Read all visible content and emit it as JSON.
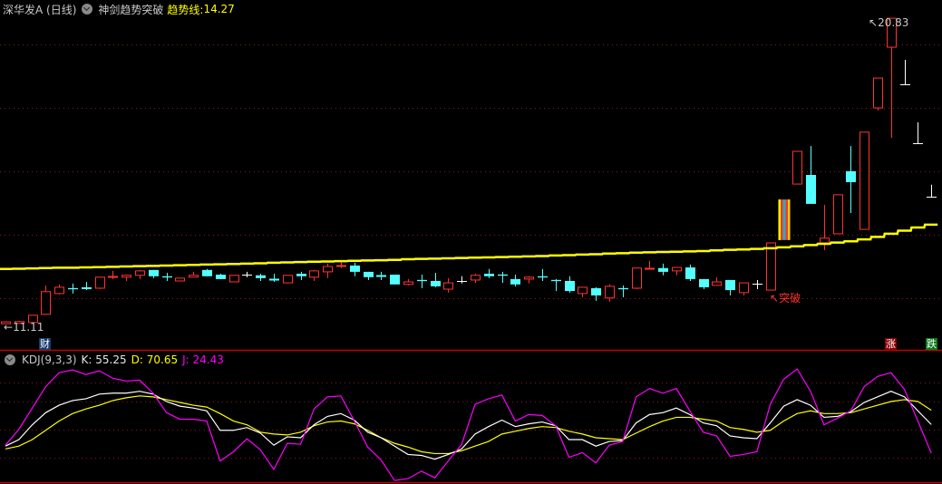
{
  "header": {
    "stock": "深华发A (日线)",
    "indicator_name": "神剑趋势突破",
    "trend_label": "趋势线:",
    "trend_value": "14.27"
  },
  "kdj_header": {
    "label": "KDJ(9,3,3)",
    "k": "K: 55.25",
    "d": "D: 70.65",
    "j": "J: 24.43"
  },
  "labels": {
    "max_price": "20.83",
    "min_price": "11.11",
    "breakout": "突破",
    "badge_finance": "财",
    "badge_up": "涨",
    "badge_down": "跌"
  },
  "colors": {
    "up": "#ff3232",
    "down": "#54ffff",
    "doji": "#ffffff",
    "trend": "#ffff00",
    "k": "#ffffff",
    "d": "#ffff00",
    "j": "#ff00ff",
    "grid": "#8b1a1a",
    "divider": "#c00000"
  },
  "chart_data": [
    {
      "type": "candlestick",
      "title": "深华发A (日线)",
      "ylim": [
        10.29,
        21.41
      ],
      "max_label": 20.83,
      "min_label": 11.11,
      "breakout_index": 58,
      "ohlc": [
        [
          11.12,
          11.2,
          11.11,
          11.18
        ],
        [
          11.13,
          11.21,
          11.12,
          11.19
        ],
        [
          11.16,
          11.39,
          11.15,
          11.39
        ],
        [
          11.42,
          12.34,
          11.4,
          12.14
        ],
        [
          12.08,
          12.37,
          12.05,
          12.28
        ],
        [
          12.26,
          12.4,
          12.08,
          12.25
        ],
        [
          12.28,
          12.45,
          12.19,
          12.22
        ],
        [
          12.25,
          12.6,
          12.22,
          12.6
        ],
        [
          12.6,
          12.8,
          12.54,
          12.63
        ],
        [
          12.6,
          12.68,
          12.48,
          12.66
        ],
        [
          12.66,
          12.83,
          12.54,
          12.8
        ],
        [
          12.83,
          12.83,
          12.57,
          12.63
        ],
        [
          12.61,
          12.74,
          12.48,
          12.6
        ],
        [
          12.48,
          12.57,
          12.48,
          12.57
        ],
        [
          12.6,
          12.77,
          12.6,
          12.66
        ],
        [
          12.83,
          12.86,
          12.63,
          12.63
        ],
        [
          12.68,
          12.71,
          12.54,
          12.54
        ],
        [
          12.45,
          12.66,
          12.45,
          12.66
        ],
        [
          12.68,
          12.77,
          12.6,
          12.68
        ],
        [
          12.66,
          12.71,
          12.48,
          12.57
        ],
        [
          12.54,
          12.71,
          12.45,
          12.51
        ],
        [
          12.42,
          12.66,
          12.42,
          12.66
        ],
        [
          12.71,
          12.77,
          12.51,
          12.63
        ],
        [
          12.6,
          12.83,
          12.48,
          12.8
        ],
        [
          12.77,
          13.03,
          12.57,
          12.94
        ],
        [
          12.94,
          13.14,
          12.89,
          12.97
        ],
        [
          12.97,
          13.06,
          12.63,
          12.77
        ],
        [
          12.77,
          12.77,
          12.51,
          12.6
        ],
        [
          12.66,
          12.77,
          12.51,
          12.63
        ],
        [
          12.68,
          12.68,
          12.37,
          12.37
        ],
        [
          12.37,
          12.54,
          12.34,
          12.45
        ],
        [
          12.52,
          12.68,
          12.25,
          12.51
        ],
        [
          12.48,
          12.74,
          12.28,
          12.31
        ],
        [
          12.22,
          12.57,
          12.11,
          12.42
        ],
        [
          12.48,
          12.63,
          12.4,
          12.48
        ],
        [
          12.51,
          12.71,
          12.42,
          12.66
        ],
        [
          12.71,
          12.86,
          12.57,
          12.63
        ],
        [
          12.69,
          12.77,
          12.42,
          12.68
        ],
        [
          12.54,
          12.68,
          12.31,
          12.37
        ],
        [
          12.54,
          12.63,
          12.4,
          12.6
        ],
        [
          12.61,
          12.86,
          12.48,
          12.6
        ],
        [
          12.52,
          12.54,
          12.16,
          12.51
        ],
        [
          12.48,
          12.63,
          12.11,
          12.16
        ],
        [
          12.08,
          12.28,
          11.96,
          12.28
        ],
        [
          12.25,
          12.28,
          11.85,
          12.02
        ],
        [
          11.94,
          12.37,
          11.82,
          12.31
        ],
        [
          12.26,
          12.34,
          11.96,
          12.25
        ],
        [
          12.25,
          12.89,
          12.22,
          12.89
        ],
        [
          12.86,
          13.12,
          12.86,
          12.89
        ],
        [
          12.89,
          13.03,
          12.66,
          12.77
        ],
        [
          12.8,
          12.91,
          12.66,
          12.91
        ],
        [
          12.91,
          13.0,
          12.48,
          12.54
        ],
        [
          12.54,
          12.54,
          12.22,
          12.28
        ],
        [
          12.34,
          12.6,
          12.34,
          12.45
        ],
        [
          12.51,
          12.51,
          12.02,
          12.19
        ],
        [
          12.11,
          12.42,
          12.02,
          12.42
        ],
        [
          12.4,
          12.51,
          12.22,
          12.4
        ],
        [
          12.19,
          13.69,
          12.19,
          13.69
        ],
        [
          13.78,
          15.07,
          13.23,
          15.07
        ],
        [
          15.56,
          16.6,
          15.56,
          16.6
        ],
        [
          15.85,
          16.77,
          14.93,
          14.93
        ],
        [
          13.69,
          14.9,
          13.46,
          13.84
        ],
        [
          13.98,
          15.22,
          13.98,
          15.22
        ],
        [
          15.97,
          16.77,
          14.64,
          15.62
        ],
        [
          14.12,
          17.21,
          14.12,
          17.21
        ],
        [
          17.98,
          18.93,
          17.9,
          18.93
        ],
        [
          19.91,
          20.83,
          17.03,
          20.83
        ],
        [
          18.73,
          19.51,
          18.73,
          18.73
        ],
        [
          16.86,
          17.52,
          16.86,
          16.86
        ],
        [
          15.16,
          15.54,
          15.16,
          15.16
        ]
      ],
      "series": [
        {
          "name": "趋势线",
          "values": [
            12.86,
            12.87,
            12.88,
            12.89,
            12.9,
            12.9,
            12.91,
            12.92,
            12.93,
            12.94,
            12.95,
            12.96,
            12.97,
            12.98,
            12.99,
            13.0,
            13.01,
            13.02,
            13.03,
            13.04,
            13.06,
            13.07,
            13.08,
            13.09,
            13.1,
            13.11,
            13.12,
            13.13,
            13.14,
            13.15,
            13.17,
            13.18,
            13.19,
            13.2,
            13.21,
            13.22,
            13.23,
            13.24,
            13.25,
            13.26,
            13.27,
            13.29,
            13.3,
            13.32,
            13.33,
            13.35,
            13.36,
            13.38,
            13.39,
            13.4,
            13.41,
            13.42,
            13.43,
            13.45,
            13.47,
            13.48,
            13.5,
            13.52,
            13.55,
            13.58,
            13.62,
            13.66,
            13.7,
            13.74,
            13.8,
            13.88,
            13.98,
            14.08,
            14.18,
            14.27
          ]
        }
      ]
    },
    {
      "type": "line",
      "title": "KDJ(9,3,3)",
      "ylim": [
        -6.8,
        134.6
      ],
      "gridlines": [
        0,
        20,
        50,
        80,
        100
      ],
      "series": [
        {
          "name": "K",
          "values": [
            32,
            39,
            55,
            68,
            76,
            81,
            83,
            88,
            89,
            89,
            91,
            88,
            80,
            75,
            73,
            70,
            49,
            49,
            52,
            46,
            33,
            42,
            41,
            55,
            64,
            67,
            60,
            47,
            41,
            32,
            23,
            22,
            18,
            23,
            29,
            45,
            53,
            60,
            53,
            56,
            58,
            54,
            39,
            39,
            32,
            37,
            38,
            57,
            66,
            68,
            73,
            66,
            57,
            54,
            43,
            41,
            40,
            57,
            75,
            82,
            76,
            63,
            64,
            69,
            79,
            85,
            91,
            85,
            70,
            55.25
          ]
        },
        {
          "name": "D",
          "values": [
            29,
            32,
            39,
            49,
            59,
            67,
            72,
            76,
            81,
            84,
            86,
            85,
            82,
            79,
            76,
            74,
            67,
            59,
            55,
            47,
            45,
            44,
            47,
            54,
            58,
            59,
            56,
            49,
            41,
            35,
            31,
            26,
            24,
            24,
            27,
            32,
            37,
            45,
            48,
            51,
            53,
            52,
            48,
            45,
            41,
            40,
            39,
            46,
            53,
            59,
            63,
            63,
            61,
            59,
            52,
            50,
            47,
            49,
            59,
            67,
            70,
            67,
            67,
            68,
            72,
            76,
            80,
            82,
            80,
            70.65
          ]
        },
        {
          "name": "J",
          "values": [
            33,
            50,
            73,
            96,
            111,
            114,
            109,
            113,
            105,
            102,
            103,
            89,
            68,
            61,
            61,
            59,
            16,
            26,
            40,
            28,
            7,
            35,
            34,
            72,
            85,
            86,
            59,
            31,
            17,
            -5,
            -3,
            5,
            -2,
            16,
            34,
            77,
            83,
            87,
            59,
            66,
            65,
            54,
            20,
            25,
            14,
            33,
            37,
            85,
            94,
            89,
            94,
            70,
            47,
            43,
            21,
            23,
            26,
            77,
            104,
            115,
            91,
            55,
            62,
            70,
            96,
            107,
            111,
            93,
            59,
            24.43
          ]
        }
      ]
    }
  ]
}
